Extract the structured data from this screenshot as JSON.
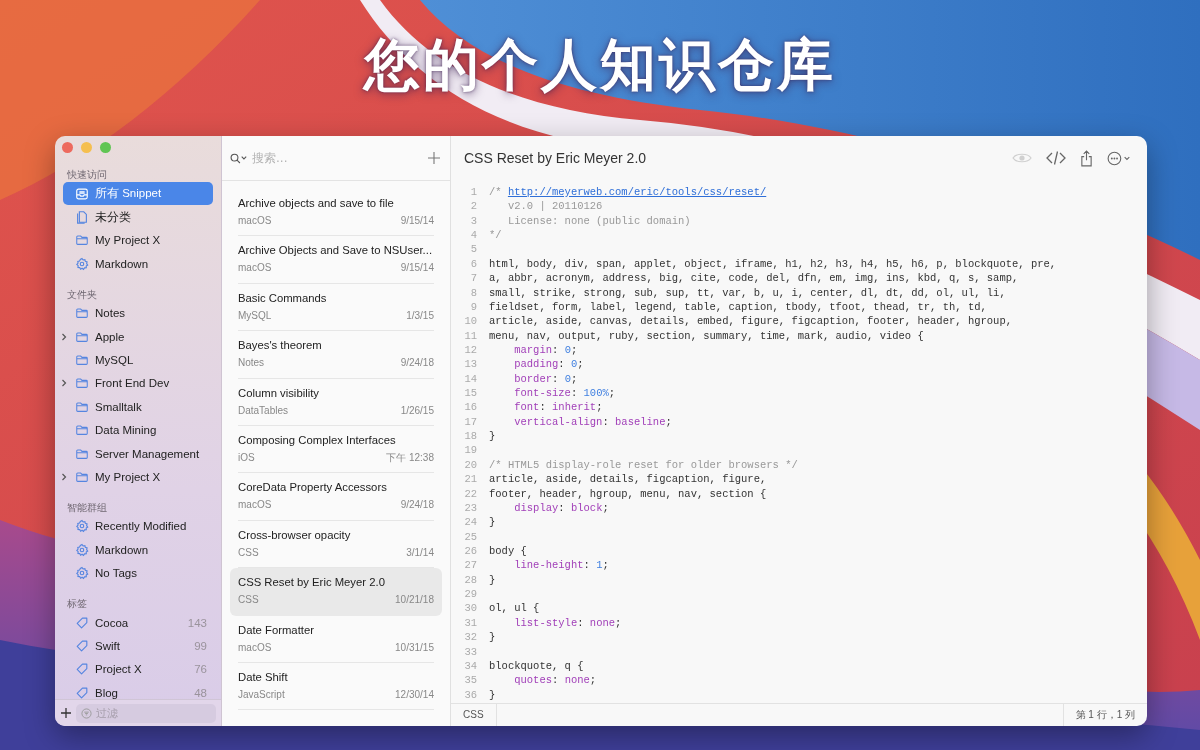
{
  "headline": "您的个人知识仓库",
  "sidebar": {
    "sections": [
      {
        "heading": "快速访问",
        "items": [
          {
            "label": "所有 Snippet",
            "kind": "tray",
            "selected": true,
            "collapsed": false
          },
          {
            "label": "未分类",
            "kind": "document",
            "selected": false,
            "collapsed": false
          },
          {
            "label": "My Project X",
            "kind": "folder",
            "selected": false,
            "collapsed": false
          },
          {
            "label": "Markdown",
            "kind": "smart",
            "selected": false,
            "collapsed": false
          }
        ]
      },
      {
        "heading": "文件夹",
        "items": [
          {
            "label": "Notes",
            "kind": "folder",
            "selected": false,
            "collapsed": false
          },
          {
            "label": "Apple",
            "kind": "folder",
            "selected": false,
            "collapsed": true
          },
          {
            "label": "MySQL",
            "kind": "folder",
            "selected": false,
            "collapsed": false
          },
          {
            "label": "Front End Dev",
            "kind": "folder",
            "selected": false,
            "collapsed": true
          },
          {
            "label": "Smalltalk",
            "kind": "folder",
            "selected": false,
            "collapsed": false
          },
          {
            "label": "Data Mining",
            "kind": "folder",
            "selected": false,
            "collapsed": false
          },
          {
            "label": "Server Management",
            "kind": "folder",
            "selected": false,
            "collapsed": false
          },
          {
            "label": "My Project X",
            "kind": "folder",
            "selected": false,
            "collapsed": true
          }
        ]
      },
      {
        "heading": "智能群组",
        "items": [
          {
            "label": "Recently Modified",
            "kind": "smart",
            "selected": false,
            "collapsed": false
          },
          {
            "label": "Markdown",
            "kind": "smart",
            "selected": false,
            "collapsed": false
          },
          {
            "label": "No Tags",
            "kind": "smart",
            "selected": false,
            "collapsed": false
          }
        ]
      },
      {
        "heading": "标签",
        "items": [
          {
            "label": "Cocoa",
            "kind": "tag",
            "selected": false,
            "collapsed": false,
            "count": "143"
          },
          {
            "label": "Swift",
            "kind": "tag",
            "selected": false,
            "collapsed": false,
            "count": "99"
          },
          {
            "label": "Project X",
            "kind": "tag",
            "selected": false,
            "collapsed": false,
            "count": "76"
          },
          {
            "label": "Blog",
            "kind": "tag",
            "selected": false,
            "collapsed": false,
            "count": "48"
          }
        ]
      }
    ],
    "filter": {
      "placeholder": "过滤"
    }
  },
  "snippet_list": {
    "search": {
      "placeholder": "搜索..."
    },
    "items": [
      {
        "title": "Archive objects and save to file",
        "folder": "macOS",
        "date": "9/15/14",
        "selected": false
      },
      {
        "title": "Archive Objects and Save to NSUser...",
        "folder": "macOS",
        "date": "9/15/14",
        "selected": false
      },
      {
        "title": "Basic Commands",
        "folder": "MySQL",
        "date": "1/3/15",
        "selected": false
      },
      {
        "title": "Bayes's theorem",
        "folder": "Notes",
        "date": "9/24/18",
        "selected": false
      },
      {
        "title": "Column visibility",
        "folder": "DataTables",
        "date": "1/26/15",
        "selected": false
      },
      {
        "title": "Composing Complex Interfaces",
        "folder": "iOS",
        "date": "下午 12:38",
        "selected": false
      },
      {
        "title": "CoreData Property Accessors",
        "folder": "macOS",
        "date": "9/24/18",
        "selected": false
      },
      {
        "title": "Cross-browser opacity",
        "folder": "CSS",
        "date": "3/1/14",
        "selected": false
      },
      {
        "title": "CSS Reset by Eric Meyer 2.0",
        "folder": "CSS",
        "date": "10/21/18",
        "selected": true
      },
      {
        "title": "Date Formatter",
        "folder": "macOS",
        "date": "10/31/15",
        "selected": false
      },
      {
        "title": "Date Shift",
        "folder": "JavaScript",
        "date": "12/30/14",
        "selected": false
      }
    ]
  },
  "editor": {
    "title": "CSS Reset by Eric Meyer 2.0",
    "lines": [
      {
        "n": "1",
        "tokens": [
          {
            "kind": "comment",
            "text": "/* "
          },
          {
            "kind": "link",
            "text": "http://meyerweb.com/eric/tools/css/reset/"
          }
        ]
      },
      {
        "n": "2",
        "tokens": [
          {
            "kind": "comment",
            "text": "   v2.0 | 20110126"
          }
        ]
      },
      {
        "n": "3",
        "tokens": [
          {
            "kind": "comment",
            "text": "   License: none (public domain)"
          }
        ]
      },
      {
        "n": "4",
        "tokens": [
          {
            "kind": "comment",
            "text": "*/"
          }
        ]
      },
      {
        "n": "5"
      },
      {
        "n": "6",
        "tokens": [
          {
            "kind": "plain",
            "text": "html, body, div, span, applet, object, iframe, h1, h2, h3, h4, h5, h6, p, blockquote, pre,"
          }
        ]
      },
      {
        "n": "7",
        "tokens": [
          {
            "kind": "plain",
            "text": "a, abbr, acronym, address, big, cite, code, del, dfn, em, img, ins, kbd, q, s, samp,"
          }
        ]
      },
      {
        "n": "8",
        "tokens": [
          {
            "kind": "plain",
            "text": "small, strike, strong, sub, sup, tt, var, b, u, i, center, dl, dt, dd, ol, ul, li,"
          }
        ]
      },
      {
        "n": "9",
        "tokens": [
          {
            "kind": "plain",
            "text": "fieldset, form, label, legend, table, caption, tbody, tfoot, thead, tr, th, td,"
          }
        ]
      },
      {
        "n": "10",
        "tokens": [
          {
            "kind": "plain",
            "text": "article, aside, canvas, details, embed, figure, figcaption, footer, header, hgroup,"
          }
        ]
      },
      {
        "n": "11",
        "tokens": [
          {
            "kind": "plain",
            "text": "menu, nav, output, ruby, section, summary, time, mark, audio, video {"
          }
        ]
      },
      {
        "n": "12",
        "tokens": [
          {
            "kind": "prop",
            "text": "    margin"
          },
          {
            "kind": "plain",
            "text": ": "
          },
          {
            "kind": "number",
            "text": "0"
          },
          {
            "kind": "plain",
            "text": ";"
          }
        ]
      },
      {
        "n": "13",
        "tokens": [
          {
            "kind": "prop",
            "text": "    padding"
          },
          {
            "kind": "plain",
            "text": ": "
          },
          {
            "kind": "number",
            "text": "0"
          },
          {
            "kind": "plain",
            "text": ";"
          }
        ]
      },
      {
        "n": "14",
        "tokens": [
          {
            "kind": "prop",
            "text": "    border"
          },
          {
            "kind": "plain",
            "text": ": "
          },
          {
            "kind": "number",
            "text": "0"
          },
          {
            "kind": "plain",
            "text": ";"
          }
        ]
      },
      {
        "n": "15",
        "tokens": [
          {
            "kind": "prop",
            "text": "    font-size"
          },
          {
            "kind": "plain",
            "text": ": "
          },
          {
            "kind": "number",
            "text": "100%"
          },
          {
            "kind": "plain",
            "text": ";"
          }
        ]
      },
      {
        "n": "16",
        "tokens": [
          {
            "kind": "prop",
            "text": "    font"
          },
          {
            "kind": "plain",
            "text": ": "
          },
          {
            "kind": "value",
            "text": "inherit"
          },
          {
            "kind": "plain",
            "text": ";"
          }
        ]
      },
      {
        "n": "17",
        "tokens": [
          {
            "kind": "prop",
            "text": "    vertical-align"
          },
          {
            "kind": "plain",
            "text": ": "
          },
          {
            "kind": "value",
            "text": "baseline"
          },
          {
            "kind": "plain",
            "text": ";"
          }
        ]
      },
      {
        "n": "18",
        "tokens": [
          {
            "kind": "plain",
            "text": "}"
          }
        ]
      },
      {
        "n": "19"
      },
      {
        "n": "20",
        "tokens": [
          {
            "kind": "comment",
            "text": "/* HTML5 display-role reset for older browsers */"
          }
        ]
      },
      {
        "n": "21",
        "tokens": [
          {
            "kind": "plain",
            "text": "article, aside, details, figcaption, figure,"
          }
        ]
      },
      {
        "n": "22",
        "tokens": [
          {
            "kind": "plain",
            "text": "footer, header, hgroup, menu, nav, section {"
          }
        ]
      },
      {
        "n": "23",
        "tokens": [
          {
            "kind": "prop",
            "text": "    display"
          },
          {
            "kind": "plain",
            "text": ": "
          },
          {
            "kind": "value",
            "text": "block"
          },
          {
            "kind": "plain",
            "text": ";"
          }
        ]
      },
      {
        "n": "24",
        "tokens": [
          {
            "kind": "plain",
            "text": "}"
          }
        ]
      },
      {
        "n": "25"
      },
      {
        "n": "26",
        "tokens": [
          {
            "kind": "plain",
            "text": "body {"
          }
        ]
      },
      {
        "n": "27",
        "tokens": [
          {
            "kind": "prop",
            "text": "    line-height"
          },
          {
            "kind": "plain",
            "text": ": "
          },
          {
            "kind": "number",
            "text": "1"
          },
          {
            "kind": "plain",
            "text": ";"
          }
        ]
      },
      {
        "n": "28",
        "tokens": [
          {
            "kind": "plain",
            "text": "}"
          }
        ]
      },
      {
        "n": "29"
      },
      {
        "n": "30",
        "tokens": [
          {
            "kind": "plain",
            "text": "ol, ul {"
          }
        ]
      },
      {
        "n": "31",
        "tokens": [
          {
            "kind": "prop",
            "text": "    list-style"
          },
          {
            "kind": "plain",
            "text": ": "
          },
          {
            "kind": "value",
            "text": "none"
          },
          {
            "kind": "plain",
            "text": ";"
          }
        ]
      },
      {
        "n": "32",
        "tokens": [
          {
            "kind": "plain",
            "text": "}"
          }
        ]
      },
      {
        "n": "33"
      },
      {
        "n": "34",
        "tokens": [
          {
            "kind": "plain",
            "text": "blockquote, q {"
          }
        ]
      },
      {
        "n": "35",
        "tokens": [
          {
            "kind": "prop",
            "text": "    quotes"
          },
          {
            "kind": "plain",
            "text": ": "
          },
          {
            "kind": "value",
            "text": "none"
          },
          {
            "kind": "plain",
            "text": ";"
          }
        ]
      },
      {
        "n": "36",
        "tokens": [
          {
            "kind": "plain",
            "text": "}"
          }
        ]
      }
    ],
    "status_bar": {
      "language": "CSS",
      "position": "第 1 行，1 列"
    }
  }
}
